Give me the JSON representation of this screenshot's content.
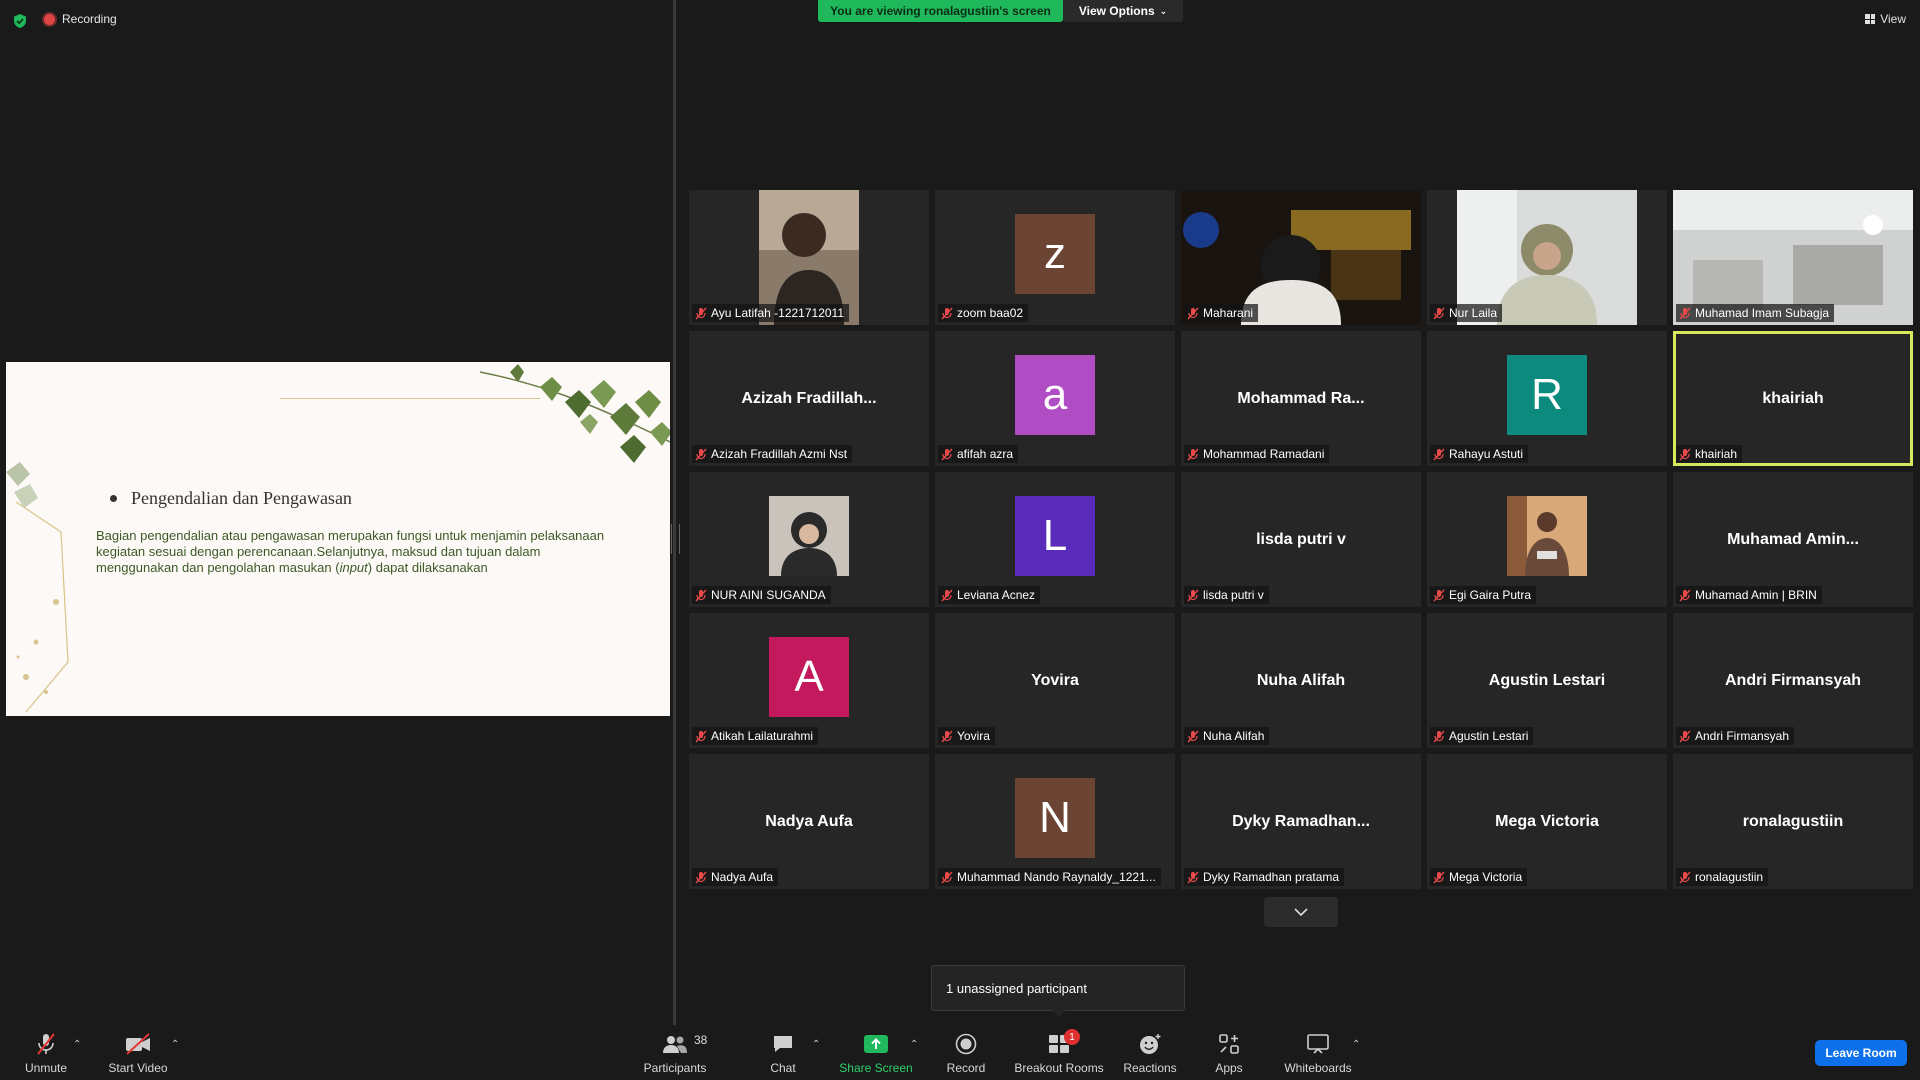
{
  "top": {
    "recording_label": "Recording",
    "banner_text": "You are viewing ronalagustiin's screen",
    "view_options_label": "View Options",
    "view_label": "View"
  },
  "slide": {
    "bullet_title": "Pengendalian dan Pengawasan",
    "para_1": "Bagian pengendalian atau pengawasan merupakan fungsi untuk menjamin pelaksanaan kegiatan sesuai dengan perencanaan.Selanjutnya, maksud dan tujuan dalam menggunakan dan pengolahan masukan (",
    "para_italic": "input",
    "para_2": ") dapat dilaksanakan"
  },
  "participants": [
    {
      "name": "Ayu Latifah -1221712011",
      "type": "video",
      "scene": "person"
    },
    {
      "name": "zoom baa02",
      "type": "avatar",
      "letter": "z",
      "color": "#6b4434"
    },
    {
      "name": "Maharani",
      "type": "video",
      "scene": "night"
    },
    {
      "name": "Nur Laila",
      "type": "video",
      "scene": "hijab"
    },
    {
      "name": "Muhamad Imam Subagja",
      "type": "video",
      "scene": "room"
    },
    {
      "name": "Azizah Fradillah Azmi Nst",
      "type": "text",
      "display": "Azizah  Fradillah..."
    },
    {
      "name": "afifah azra",
      "type": "avatar",
      "letter": "a",
      "color": "#b04cc4"
    },
    {
      "name": "Mohammad Ramadani",
      "type": "text",
      "display": "Mohammad  Ra..."
    },
    {
      "name": "Rahayu Astuti",
      "type": "avatar",
      "letter": "R",
      "color": "#0c8a7e"
    },
    {
      "name": "khairiah",
      "type": "text",
      "display": "khairiah",
      "active": true
    },
    {
      "name": "NUR AINI SUGANDA",
      "type": "thumb",
      "scene": "hijab-photo"
    },
    {
      "name": "Leviana Acnez",
      "type": "avatar",
      "letter": "L",
      "color": "#5a2ab8"
    },
    {
      "name": "lisda putri v",
      "type": "text",
      "display": "lisda putri v"
    },
    {
      "name": "Egi Gaira Putra",
      "type": "thumb",
      "scene": "man-photo"
    },
    {
      "name": "Muhamad Amin | BRIN",
      "type": "text",
      "display": "Muhamad  Amin..."
    },
    {
      "name": "Atikah Lailaturahmi",
      "type": "avatar",
      "letter": "A",
      "color": "#c21a5c"
    },
    {
      "name": "Yovira",
      "type": "text",
      "display": "Yovira"
    },
    {
      "name": "Nuha Alifah",
      "type": "text",
      "display": "Nuha Alifah"
    },
    {
      "name": "Agustin Lestari",
      "type": "text",
      "display": "Agustin Lestari"
    },
    {
      "name": "Andri Firmansyah",
      "type": "text",
      "display": "Andri Firmansyah"
    },
    {
      "name": "Nadya Aufa",
      "type": "text",
      "display": "Nadya Aufa"
    },
    {
      "name": "Muhammad Nando Raynaldy_1221...",
      "type": "avatar",
      "letter": "N",
      "color": "#6b4434"
    },
    {
      "name": "Dyky Ramadhan pratama",
      "type": "text",
      "display": "Dyky  Ramadhan..."
    },
    {
      "name": "Mega Victoria",
      "type": "text",
      "display": "Mega Victoria"
    },
    {
      "name": "ronalagustiin",
      "type": "text",
      "display": "ronalagustiin"
    }
  ],
  "tooltip": "1 unassigned participant",
  "toolbar": {
    "unmute": "Unmute",
    "start_video": "Start Video",
    "participants": "Participants",
    "participant_count": "38",
    "chat": "Chat",
    "share_screen": "Share Screen",
    "record": "Record",
    "breakout_rooms": "Breakout Rooms",
    "breakout_badge": "1",
    "reactions": "Reactions",
    "apps": "Apps",
    "whiteboards": "Whiteboards",
    "leave_room": "Leave Room"
  }
}
